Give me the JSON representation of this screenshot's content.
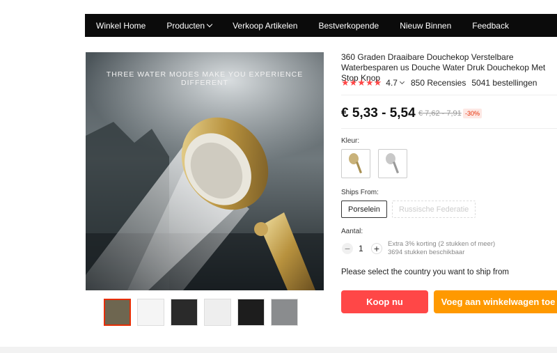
{
  "nav": {
    "items": [
      "Winkel Home",
      "Producten",
      "Verkoop Artikelen",
      "Bestverkopende",
      "Nieuw Binnen",
      "Feedback"
    ]
  },
  "gallery": {
    "caption": "THREE WATER MODES MAKE YOU EXPERIENCE DIFFERENT",
    "thumbnail_count": 6,
    "active_index": 0
  },
  "product": {
    "title": "360 Graden Draaibare Douchekop Verstelbare Waterbesparen us Douche Water Druk Douchekop Met Stop Knop",
    "stars": "★★★★★",
    "rating": "4.7",
    "reviews": "850 Recensies",
    "orders": "5041 bestellingen",
    "price": "€ 5,33 - 5,54",
    "old_price": "€ 7,62 - 7,91",
    "discount": "-30%"
  },
  "options": {
    "color_label": "Kleur:",
    "ships_from_label": "Ships From:",
    "ships_from": [
      {
        "label": "Porselein",
        "available": true
      },
      {
        "label": "Russische Federatie",
        "available": false
      }
    ],
    "quantity_label": "Aantal:",
    "quantity": "1",
    "minus": "−",
    "plus": "+",
    "extra_discount": "Extra 3% korting (2 stukken of meer)",
    "stock": "3694 stukken beschikbaar"
  },
  "notice": "Please select the country you want to ship from",
  "buttons": {
    "buy_now": "Koop nu",
    "add_to_cart": "Voeg aan winkelwagen toe"
  },
  "colors": {
    "nav_bg": "#0b0b0b",
    "buy": "#ff4747",
    "cart": "#ff9900",
    "star": "#ff4747",
    "discount": "#e62e04"
  }
}
